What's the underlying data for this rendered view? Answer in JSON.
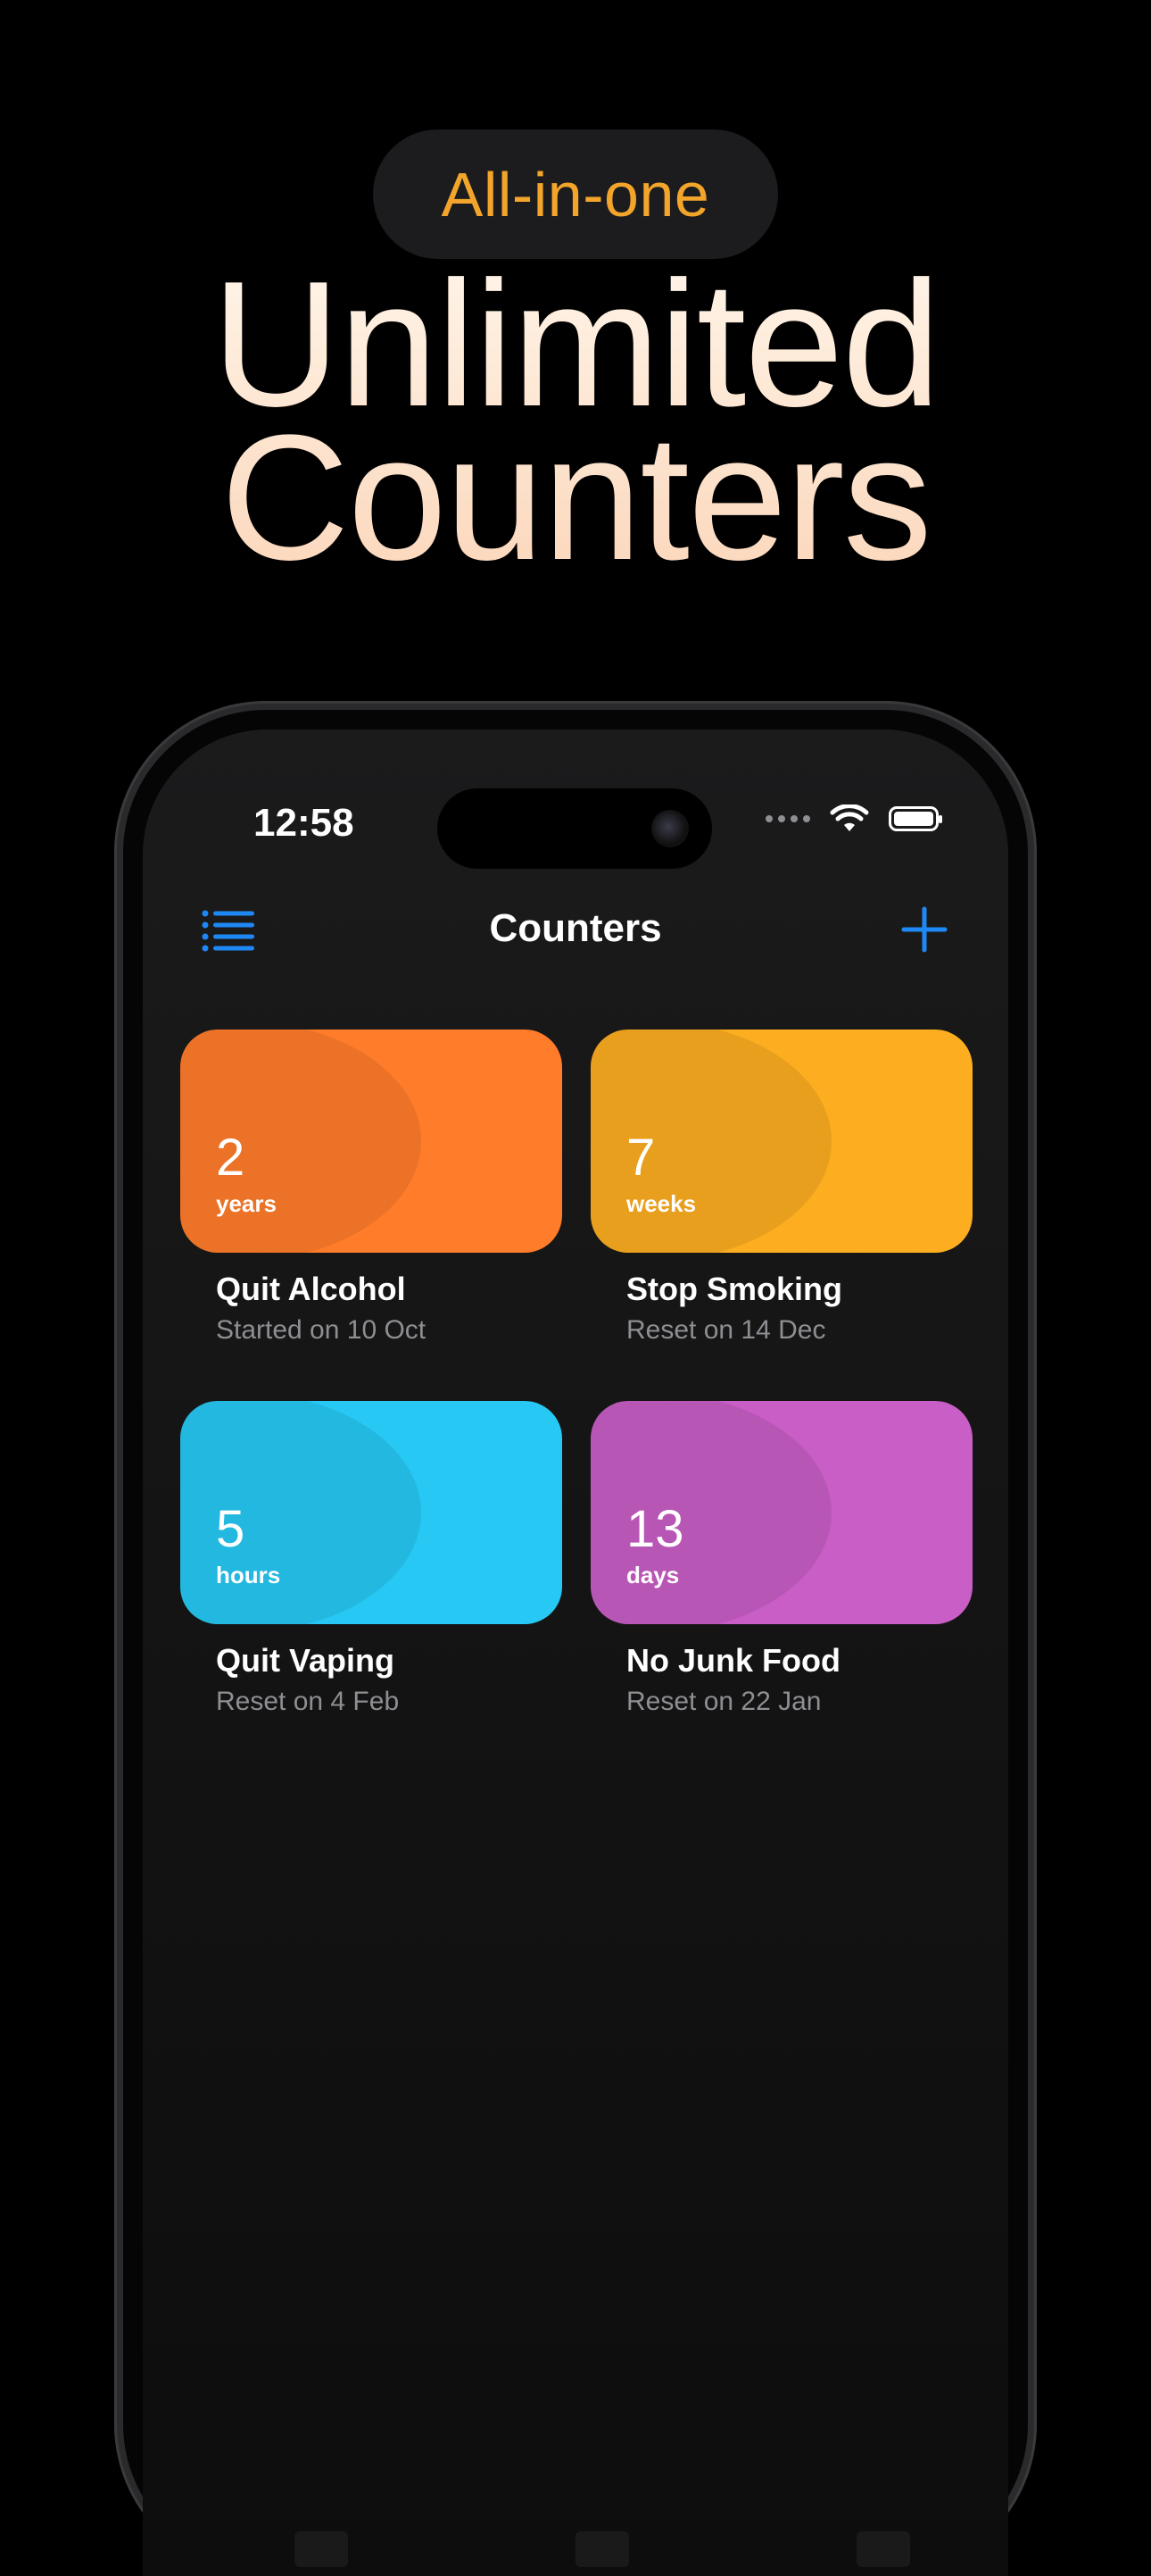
{
  "header": {
    "badge": "All-in-one",
    "headline_line1": "Unlimited",
    "headline_line2": "Counters"
  },
  "status_bar": {
    "time": "12:58"
  },
  "nav": {
    "title": "Counters",
    "left_icon": "list-icon",
    "right_icon": "plus-icon"
  },
  "counters": [
    {
      "value": "2",
      "unit": "years",
      "title": "Quit Alcohol",
      "subtitle": "Started on 10 Oct",
      "color": "#ff7c2a"
    },
    {
      "value": "7",
      "unit": "weeks",
      "title": "Stop Smoking",
      "subtitle": "Reset on 14 Dec",
      "color": "#fcad20"
    },
    {
      "value": "5",
      "unit": "hours",
      "title": "Quit Vaping",
      "subtitle": "Reset on 4 Feb",
      "color": "#27c8f4"
    },
    {
      "value": "13",
      "unit": "days",
      "title": "No Junk Food",
      "subtitle": "Reset on 22 Jan",
      "color": "#c85ec6"
    }
  ],
  "colors": {
    "accent": "#f3a52b",
    "ios_blue": "#1e88f5"
  }
}
